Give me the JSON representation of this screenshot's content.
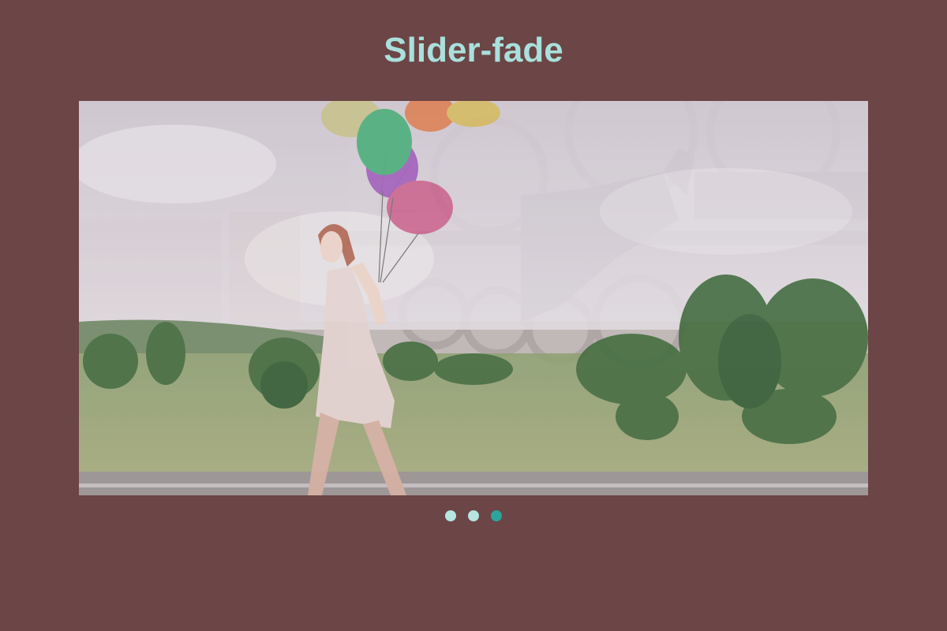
{
  "page": {
    "title": "Slider-fade"
  },
  "slider": {
    "slides": [
      {
        "name": "laundromat-jump"
      },
      {
        "name": "girl-with-balloons"
      },
      {
        "name": "meadow-landscape"
      }
    ],
    "active_index": 2
  },
  "colors": {
    "background": "#6c4546",
    "title": "#a9e0dc",
    "dot_inactive": "#b6e5e2",
    "dot_active": "#2ca49e"
  }
}
